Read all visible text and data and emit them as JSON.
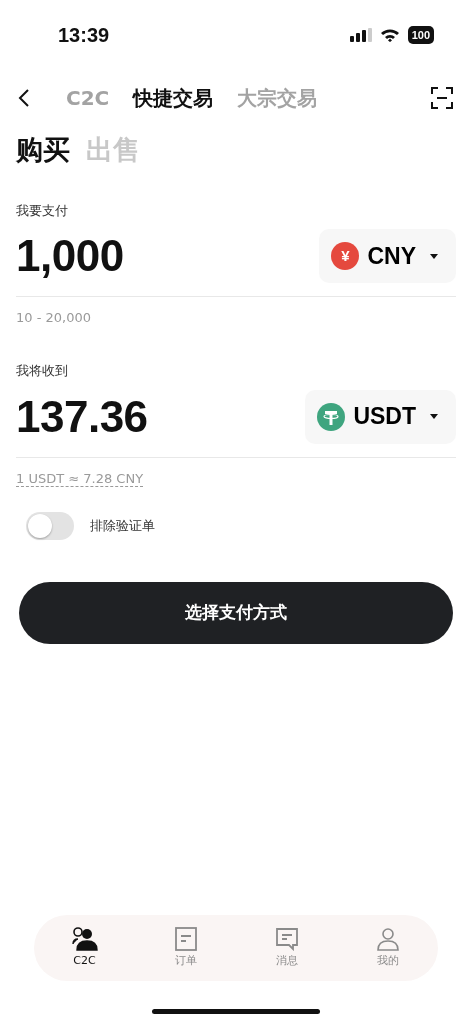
{
  "status_bar": {
    "time": "13:39",
    "battery": "100"
  },
  "top_tabs": [
    {
      "label": "C2C",
      "selected": false
    },
    {
      "label": "快捷交易",
      "selected": true
    },
    {
      "label": "大宗交易",
      "selected": false
    }
  ],
  "side_tabs": [
    {
      "label": "购买",
      "selected": true
    },
    {
      "label": "出售",
      "selected": false
    }
  ],
  "pay": {
    "label": "我要支付",
    "amount": "1,000",
    "currency": "CNY",
    "kind": "yuan",
    "symbol": "¥",
    "hint": "10 - 20,000"
  },
  "receive": {
    "label": "我将收到",
    "amount": "137.36",
    "currency": "USDT",
    "kind": "tether",
    "hint": "1 USDT ≈ 7.28 CNY"
  },
  "exclude_toggle": {
    "label": "排除验证单",
    "on": false
  },
  "primary_button": "选择支付方式",
  "bottom_nav": [
    {
      "label": "C2C",
      "kind": "people",
      "selected": true
    },
    {
      "label": "订单",
      "kind": "document",
      "selected": false
    },
    {
      "label": "消息",
      "kind": "message",
      "selected": false
    },
    {
      "label": "我的",
      "kind": "user",
      "selected": false
    }
  ]
}
